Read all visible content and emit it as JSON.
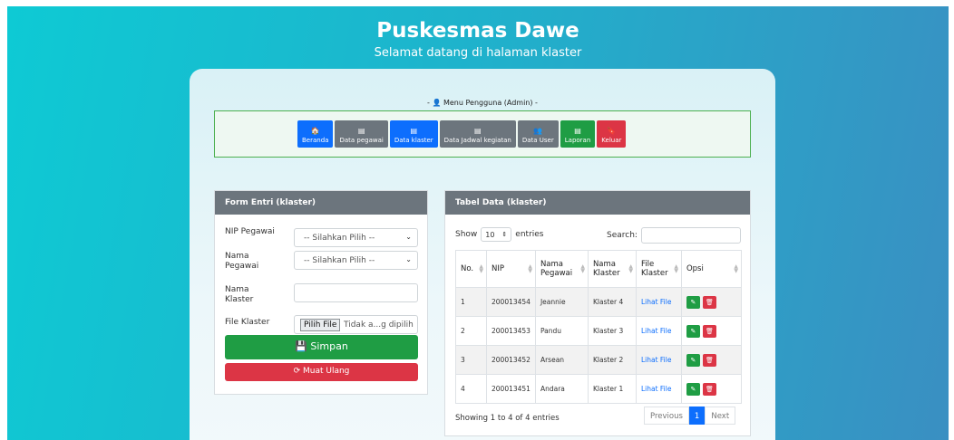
{
  "header": {
    "title": "Puskesmas Dawe",
    "subtitle": "Selamat datang di halaman klaster"
  },
  "menu": {
    "title": "- 👤 Menu Pengguna (Admin) -",
    "buttons": [
      {
        "icon": "home-icon",
        "glyph": "🏠",
        "label": "Beranda",
        "color": "#0d6efd"
      },
      {
        "icon": "card-icon",
        "glyph": "▤",
        "label": "Data pegawai",
        "color": "#6c757d"
      },
      {
        "icon": "card-icon",
        "glyph": "▤",
        "label": "Data klaster",
        "color": "#0d6efd"
      },
      {
        "icon": "card-icon",
        "glyph": "▤",
        "label": "Data Jadwal kegiatan",
        "color": "#6c757d"
      },
      {
        "icon": "users-icon",
        "glyph": "👥",
        "label": "Data User",
        "color": "#6c757d"
      },
      {
        "icon": "card-icon",
        "glyph": "▤",
        "label": "Laporan",
        "color": "#1f9d44"
      },
      {
        "icon": "bookmark-icon",
        "glyph": "🔖",
        "label": "Keluar",
        "color": "#dc3545"
      }
    ]
  },
  "form": {
    "title": "Form Entri (klaster)",
    "nip_label": "NIP Pegawai",
    "nip_value": "-- Silahkan Pilih --",
    "nama_label": "Nama Pegawai",
    "nama_value": "-- Silahkan Pilih --",
    "klaster_label": "Nama Klaster",
    "klaster_value": "",
    "file_label": "File Klaster",
    "file_button": "Pilih File",
    "file_text": "Tidak a...g dipilih",
    "save_label": "Simpan",
    "reload_label": "Muat Ulang"
  },
  "table": {
    "title": "Tabel Data (klaster)",
    "show_label": "Show",
    "show_value": "10",
    "entries_label": "entries",
    "search_label": "Search:",
    "columns": [
      "No.",
      "NIP",
      "Nama Pegawai",
      "Nama Klaster",
      "File Klaster",
      "Opsi"
    ],
    "rows": [
      {
        "no": "1",
        "nip": "200013454",
        "nama": "Jeannie",
        "klaster": "Klaster 4",
        "file": "Lihat File"
      },
      {
        "no": "2",
        "nip": "200013453",
        "nama": "Pandu",
        "klaster": "Klaster 3",
        "file": "Lihat File"
      },
      {
        "no": "3",
        "nip": "200013452",
        "nama": "Arsean",
        "klaster": "Klaster 2",
        "file": "Lihat File"
      },
      {
        "no": "4",
        "nip": "200013451",
        "nama": "Andara",
        "klaster": "Klaster 1",
        "file": "Lihat File"
      }
    ],
    "info": "Showing 1 to 4 of 4 entries",
    "pager": {
      "prev": "Previous",
      "page": "1",
      "next": "Next"
    }
  },
  "colors": {
    "primary": "#0d6efd",
    "secondary": "#6c757d",
    "success": "#1f9d44",
    "danger": "#dc3545"
  }
}
